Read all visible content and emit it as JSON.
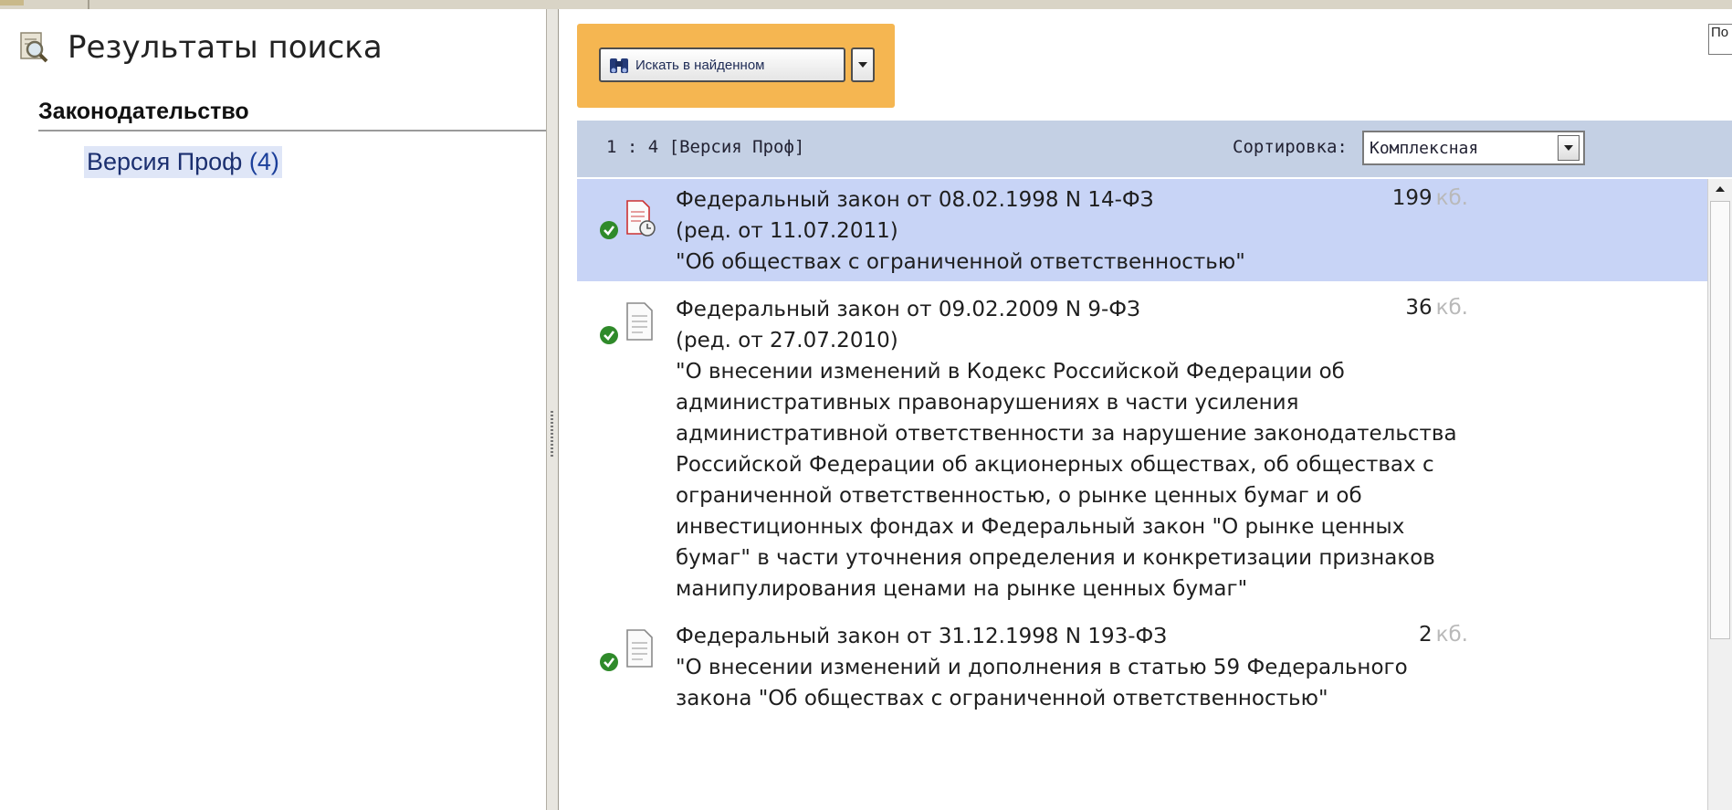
{
  "left_panel": {
    "title": "Результаты поиска",
    "section": "Законодательство",
    "tree_item": {
      "label": "Версия Проф",
      "count": "(4)"
    }
  },
  "toolbar": {
    "search_in_found_label": "Искать в найденном",
    "top_right_label": "По"
  },
  "list_header": {
    "range": "1 : 4 [Версия Проф]",
    "sort_label": "Сортировка:",
    "sort_value": "Комплексная"
  },
  "documents": [
    {
      "lines": [
        "Федеральный закон от 08.02.1998 N 14-ФЗ",
        "(ред. от 11.07.2011)",
        "\"Об обществах с ограниченной ответственностью\""
      ],
      "size": "199",
      "unit": "кб.",
      "selected": true
    },
    {
      "lines": [
        "Федеральный закон от 09.02.2009 N 9-ФЗ",
        "(ред. от 27.07.2010)",
        "\"О внесении изменений в Кодекс Российской Федерации об",
        "административных правонарушениях в части усиления",
        "административной ответственности за нарушение законодательства",
        "Российской Федерации об акционерных обществах, об обществах с",
        "ограниченной ответственностью, о рынке ценных бумаг и об",
        "инвестиционных фондах и Федеральный закон \"О рынке ценных",
        "бумаг\" в части уточнения определения и конкретизации признаков",
        "манипулирования ценами на рынке ценных бумаг\""
      ],
      "size": "36",
      "unit": "кб.",
      "selected": false
    },
    {
      "lines": [
        "Федеральный закон от 31.12.1998 N 193-ФЗ",
        "\"О внесении изменений и дополнения в статью 59 Федерального",
        "закона \"Об обществах с ограниченной ответственностью\""
      ],
      "size": "2",
      "unit": "кб.",
      "selected": false
    }
  ],
  "colors": {
    "toolbar_bg": "#f5b651",
    "header_bg": "#c4d0e4",
    "selected_row": "#c8d4f6",
    "check_green": "#2f8a2a"
  },
  "icons": [
    "search-results-icon",
    "binoculars-icon",
    "chevron-down-icon",
    "check-icon",
    "document-icon",
    "document-edit-icon",
    "scroll-up-icon"
  ]
}
